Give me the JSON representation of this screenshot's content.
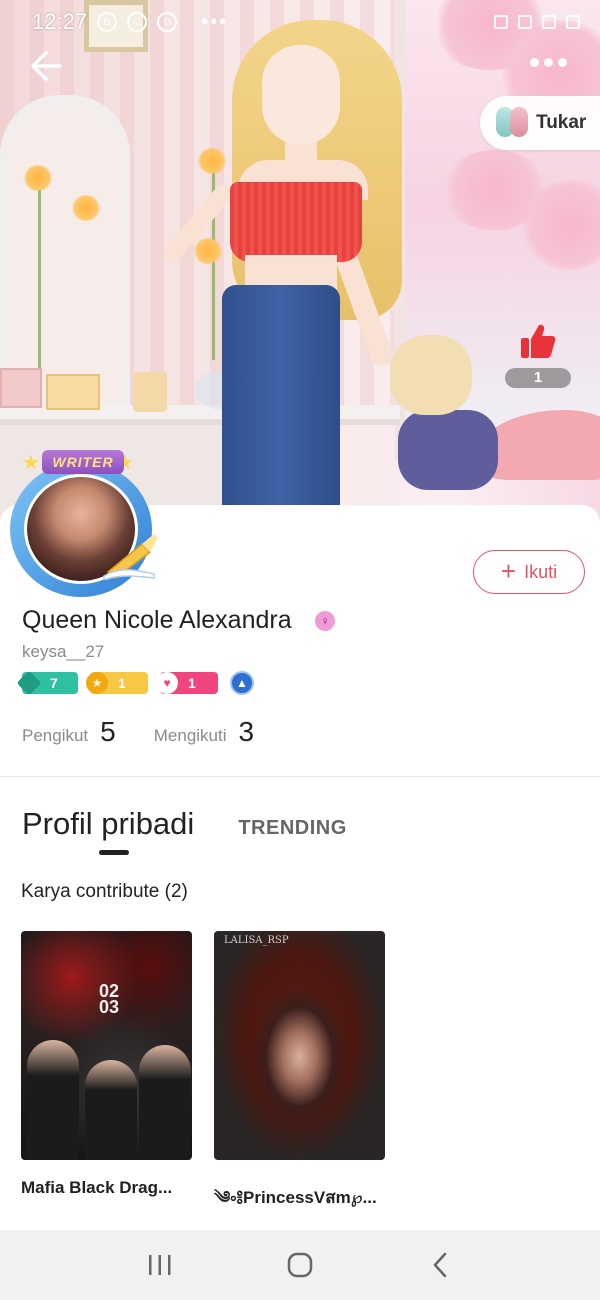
{
  "status_bar": {
    "time": "12:27",
    "icons": [
      "B",
      "☺",
      "☺"
    ],
    "more": "•••"
  },
  "hero": {
    "back_icon": "arrow-left-icon",
    "switch_label": "Tukar",
    "like_count": "1"
  },
  "profile": {
    "badge_text": "WRITER",
    "display_name": "Queen Nicole Alexandra",
    "gender_symbol": "♀",
    "username": "keysa__27",
    "follow_label": "Ikuti",
    "badges": {
      "level": "7",
      "star": "1",
      "heart": "1"
    },
    "stats": {
      "followers_label": "Pengikut",
      "followers_value": "5",
      "following_label": "Mengikuti",
      "following_value": "3"
    }
  },
  "tabs": {
    "active": "Profil pribadi",
    "inactive": "TRENDING"
  },
  "works": {
    "section_title": "Karya contribute (2)",
    "items": [
      {
        "title": "Mafia Black Drag...",
        "cover_text": "02\n03",
        "icon": "book-cover"
      },
      {
        "title": "༄༚༔PrincessVสm℘...",
        "cover_tag": "LALISA_RSP",
        "icon": "book-cover"
      }
    ]
  },
  "navbar": {
    "recent": "recent-apps-icon",
    "home": "home-icon",
    "back": "back-icon"
  },
  "colors": {
    "accent": "#e55262",
    "level_badge": "#2ec0a0",
    "star_badge": "#f6c844",
    "heart_badge": "#f0457e",
    "like_red": "#e8333b"
  }
}
